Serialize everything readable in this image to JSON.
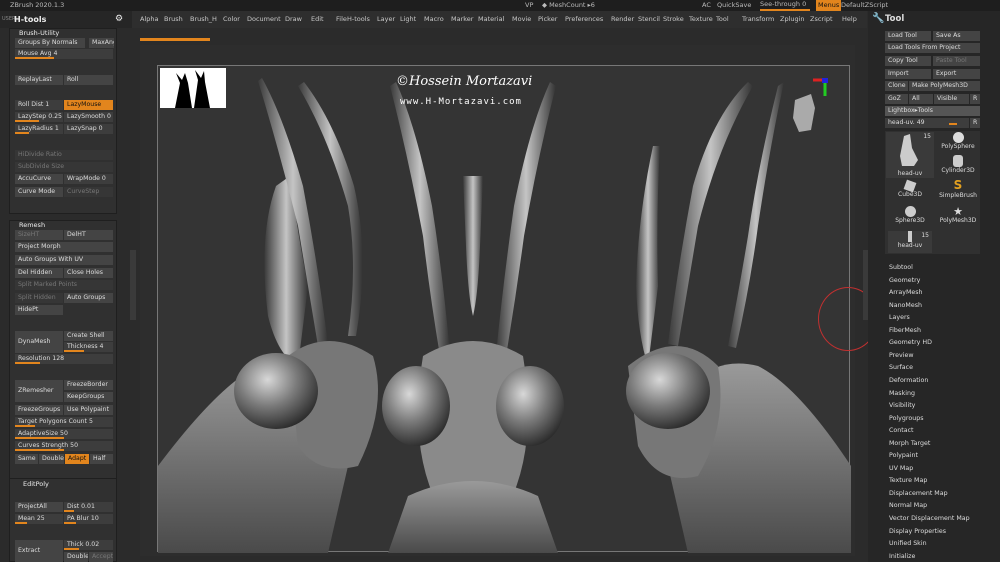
{
  "titlebar": {
    "app": "ZBrush 2020.1.3",
    "vp": "VP",
    "meshcount": "◆ MeshCount ▸6",
    "ac": "AC",
    "quicksave": "QuickSave",
    "seethrough": "See-through  0",
    "menus": "Menus",
    "script": "DefaultZScript"
  },
  "menu": [
    "Alpha",
    "Brush",
    "Brush_H",
    "Color",
    "Document",
    "Draw",
    "Edit",
    "File",
    "H-tools",
    "Layer",
    "Light",
    "Macro",
    "Marker",
    "Material",
    "Movie",
    "Picker",
    "Preferences",
    "Render",
    "Stencil",
    "Stroke",
    "Texture",
    "Tool",
    "Transform",
    "Zplugin",
    "Zscript",
    "Help"
  ],
  "left": {
    "title": "H-tools",
    "brush_utility": "Brush-Utility",
    "groups_by_normals": "Groups By Normals",
    "maxang": "MaxAngle",
    "mouse_avg": "Mouse Avg 4",
    "replaylast": "ReplayLast",
    "roll": "Roll",
    "rolldist": "Roll Dist 1",
    "lazymouse": "LazyMouse",
    "lazystep": "LazyStep 0.25",
    "lazysmooth": "LazySmooth 0",
    "lazyradius": "LazyRadius 1",
    "lazysnap": "LazySnap 0",
    "hidivide": "HiDivide Ratio",
    "subdivide": "SubDivide Size",
    "accucurve": "AccuCurve",
    "wrapmode": "WrapMode 0",
    "curvemode": "Curve Mode",
    "curvestep": "CurveStep",
    "remesh": "Remesh",
    "sizeht": "SizeHT",
    "delht": "DelHT",
    "project_morph": "Project Morph",
    "auto_groups_uv": "Auto Groups With UV",
    "del_hidden": "Del Hidden",
    "close_holes": "Close Holes",
    "split_masked": "Split Marked Points",
    "split_hidden": "Split Hidden",
    "auto_groups": "Auto Groups",
    "hidept": "HidePt",
    "dynamesh": "DynaMesh",
    "create_shell": "Create Shell",
    "thickness": "Thickness 4",
    "resolution": "Resolution 128",
    "zremesher": "ZRemesher",
    "freezeborder": "FreezeBorder",
    "keepgroups": "KeepGroups",
    "freezegroups": "FreezeGroups",
    "usepolypaint": "Use Polypaint",
    "target_polys": "Target Polygons Count 5",
    "adaptivesize": "AdaptiveSize 50",
    "curves_strength": "Curves Strength 50",
    "same": "Same",
    "double": "Double",
    "adapt": "Adapt",
    "half": "Half",
    "editpoly": "EditPoly",
    "projectall": "ProjectAll",
    "dist": "Dist 0.01",
    "mean": "Mean 25",
    "pablur": "PA Blur 10",
    "extract": "Extract",
    "thick": "Thick 0.02",
    "double2": "Double",
    "accept": "Accept"
  },
  "canvas": {
    "watermark": "©Hossein Mortazavi",
    "url": "www.H-Mortazavi.com"
  },
  "tool": {
    "title": "Tool",
    "load_tool": "Load Tool",
    "save_as": "Save As",
    "load_from_project": "Load Tools From Project",
    "copy_tool": "Copy Tool",
    "paste_tool": "Paste Tool",
    "import": "Import",
    "export": "Export",
    "clone": "Clone",
    "make_polymesh": "Make PolyMesh3D",
    "goz": "GoZ",
    "all": "All",
    "visible": "Visible",
    "r": "R",
    "lightbox": "Lightbox▸Tools",
    "headuv": "head-uv. 49",
    "r2": "R",
    "thumbs": [
      {
        "label": "head-uv",
        "count": "15"
      },
      {
        "label": "PolySphere",
        "count": ""
      },
      {
        "label": "Cylinder3D",
        "count": ""
      },
      {
        "label": "Cube3D",
        "count": ""
      },
      {
        "label": "SimpleBrush",
        "count": ""
      },
      {
        "label": "Sphere3D",
        "count": ""
      },
      {
        "label": "PolyMesh3D",
        "count": ""
      },
      {
        "label": "head-uv",
        "count": "15"
      }
    ],
    "subpalettes": [
      "Subtool",
      "Geometry",
      "ArrayMesh",
      "NanoMesh",
      "Layers",
      "FiberMesh",
      "Geometry HD",
      "Preview",
      "Surface",
      "Deformation",
      "Masking",
      "Visibility",
      "Polygroups",
      "Contact",
      "Morph Target",
      "Polypaint",
      "UV Map",
      "Texture Map",
      "Displacement Map",
      "Normal Map",
      "Vector Displacement Map",
      "Display Properties",
      "Unified Skin",
      "Initialize"
    ]
  },
  "colors": {
    "accent": "#e2851d"
  }
}
